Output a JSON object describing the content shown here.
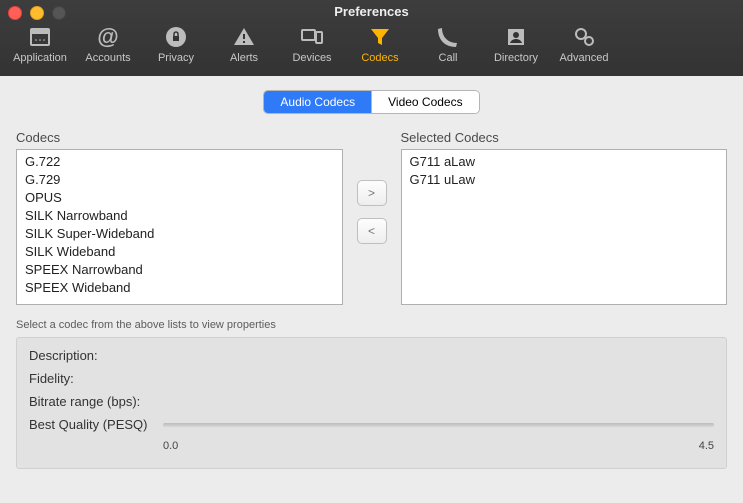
{
  "window": {
    "title": "Preferences"
  },
  "toolbar": {
    "items": [
      {
        "id": "application",
        "label": "Application"
      },
      {
        "id": "accounts",
        "label": "Accounts"
      },
      {
        "id": "privacy",
        "label": "Privacy"
      },
      {
        "id": "alerts",
        "label": "Alerts"
      },
      {
        "id": "devices",
        "label": "Devices"
      },
      {
        "id": "codecs",
        "label": "Codecs"
      },
      {
        "id": "call",
        "label": "Call"
      },
      {
        "id": "directory",
        "label": "Directory"
      },
      {
        "id": "advanced",
        "label": "Advanced"
      }
    ],
    "active": "codecs"
  },
  "segments": {
    "audio": "Audio Codecs",
    "video": "Video Codecs",
    "active": "audio"
  },
  "labels": {
    "codecs": "Codecs",
    "selected": "Selected Codecs",
    "hint": "Select a codec from the above lists to view properties",
    "description": "Description:",
    "fidelity": "Fidelity:",
    "bitrate": "Bitrate range (bps):",
    "pesq": "Best Quality (PESQ)"
  },
  "available": [
    "G.722",
    "G.729",
    "OPUS",
    "SILK Narrowband",
    "SILK Super-Wideband",
    "SILK Wideband",
    "SPEEX Narrowband",
    "SPEEX Wideband"
  ],
  "selected": [
    "G711 aLaw",
    "G711 uLaw"
  ],
  "pesq": {
    "min": "0.0",
    "max": "4.5"
  },
  "buttons": {
    "add": ">",
    "remove": "<"
  }
}
